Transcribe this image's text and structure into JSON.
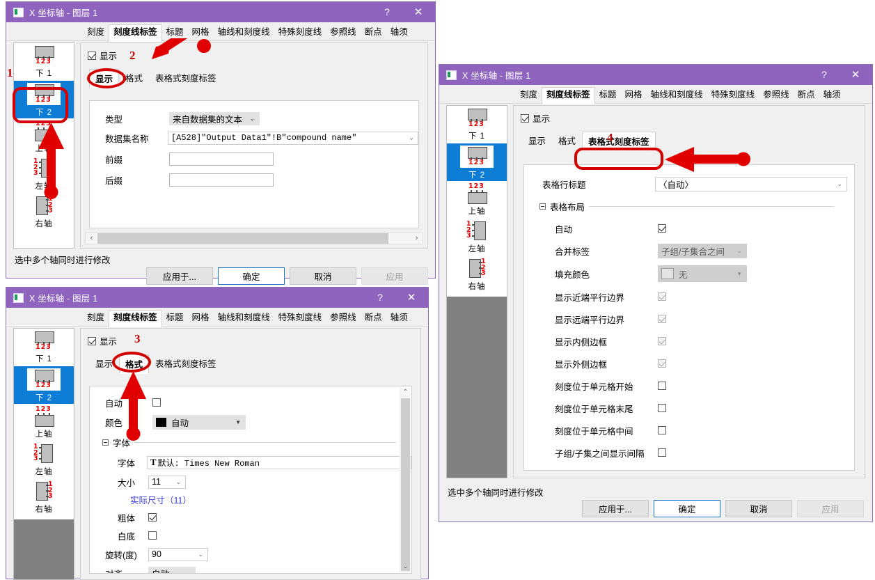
{
  "window_title": "X 坐标轴 - 图层 1",
  "titlebar_buttons": {
    "help": "?",
    "close": "✕"
  },
  "tabs": [
    "刻度",
    "刻度线标签",
    "标题",
    "网格",
    "轴线和刻度线",
    "特殊刻度线",
    "参照线",
    "断点",
    "轴须"
  ],
  "active_tab": "刻度线标签",
  "axis_list": [
    {
      "label": "下 1",
      "icon": "axis-bottom-icon",
      "selected": false
    },
    {
      "label": "下 2",
      "icon": "axis-bottom-icon",
      "selected": true
    },
    {
      "label": "上轴",
      "icon": "axis-top-icon",
      "selected": false
    },
    {
      "label": "左轴",
      "icon": "axis-left-icon",
      "selected": false
    },
    {
      "label": "右轴",
      "icon": "axis-right-icon",
      "selected": false
    }
  ],
  "show_checkbox": {
    "label": "显示",
    "checked": true
  },
  "sub_tabs": [
    "显示",
    "格式",
    "表格式刻度标签"
  ],
  "status_text": "选中多个轴同时进行修改",
  "buttons": {
    "apply_to": "应用于...",
    "ok": "确定",
    "cancel": "取消",
    "apply": "应用"
  },
  "dialog1": {
    "active_sub_tab": "显示",
    "fields": {
      "type_label": "类型",
      "type_value": "来自数据集的文本",
      "dataset_label": "数据集名称",
      "dataset_value": "[A528]\"Output Data1\"!B\"compound name\"",
      "prefix_label": "前缀",
      "prefix_value": "",
      "suffix_label": "后缀",
      "suffix_value": ""
    }
  },
  "dialog3": {
    "active_sub_tab": "格式",
    "fields": {
      "auto_label": "自动",
      "auto_checked": false,
      "color_label": "颜色",
      "color_value": "自动",
      "color_swatch": "#000000",
      "font_group": "字体",
      "font_label": "字体",
      "font_value": "默认: Times New Roman",
      "size_label": "大小",
      "size_value": "11",
      "actual_size_text": "实际尺寸（11）",
      "bold_label": "粗体",
      "bold_checked": true,
      "white_bg_label": "白底",
      "white_bg_checked": false,
      "rotate_label": "旋转(度)",
      "rotate_value": "90",
      "align_label": "对齐",
      "align_value": "自动"
    }
  },
  "dialog2": {
    "active_sub_tab": "表格式刻度标签",
    "fields": {
      "table_row_title_label": "表格行标题",
      "table_row_title_value": "〈自动〉",
      "layout_group": "表格布局",
      "rows": [
        {
          "label": "自动",
          "type": "checkbox",
          "checked": true,
          "disabled": false
        },
        {
          "label": "合并标签",
          "type": "combo",
          "value": "子组/子集合之间",
          "disabled": true
        },
        {
          "label": "填充颜色",
          "type": "color",
          "value": "无",
          "disabled": true
        },
        {
          "label": "显示近端平行边界",
          "type": "checkbox",
          "checked": true,
          "disabled": true
        },
        {
          "label": "显示远端平行边界",
          "type": "checkbox",
          "checked": true,
          "disabled": true
        },
        {
          "label": "显示内侧边框",
          "type": "checkbox",
          "checked": true,
          "disabled": true
        },
        {
          "label": "显示外侧边框",
          "type": "checkbox",
          "checked": true,
          "disabled": true
        },
        {
          "label": "刻度位于单元格开始",
          "type": "checkbox",
          "checked": false,
          "disabled": false
        },
        {
          "label": "刻度位于单元格末尾",
          "type": "checkbox",
          "checked": false,
          "disabled": false
        },
        {
          "label": "刻度位于单元格中间",
          "type": "checkbox",
          "checked": false,
          "disabled": false
        },
        {
          "label": "子组/子集之间显示间隔",
          "type": "checkbox",
          "checked": false,
          "disabled": false
        }
      ]
    }
  },
  "annotations": {
    "step1": "1",
    "step2": "2",
    "step3": "3",
    "step4": "4",
    "color": "#d40000"
  }
}
